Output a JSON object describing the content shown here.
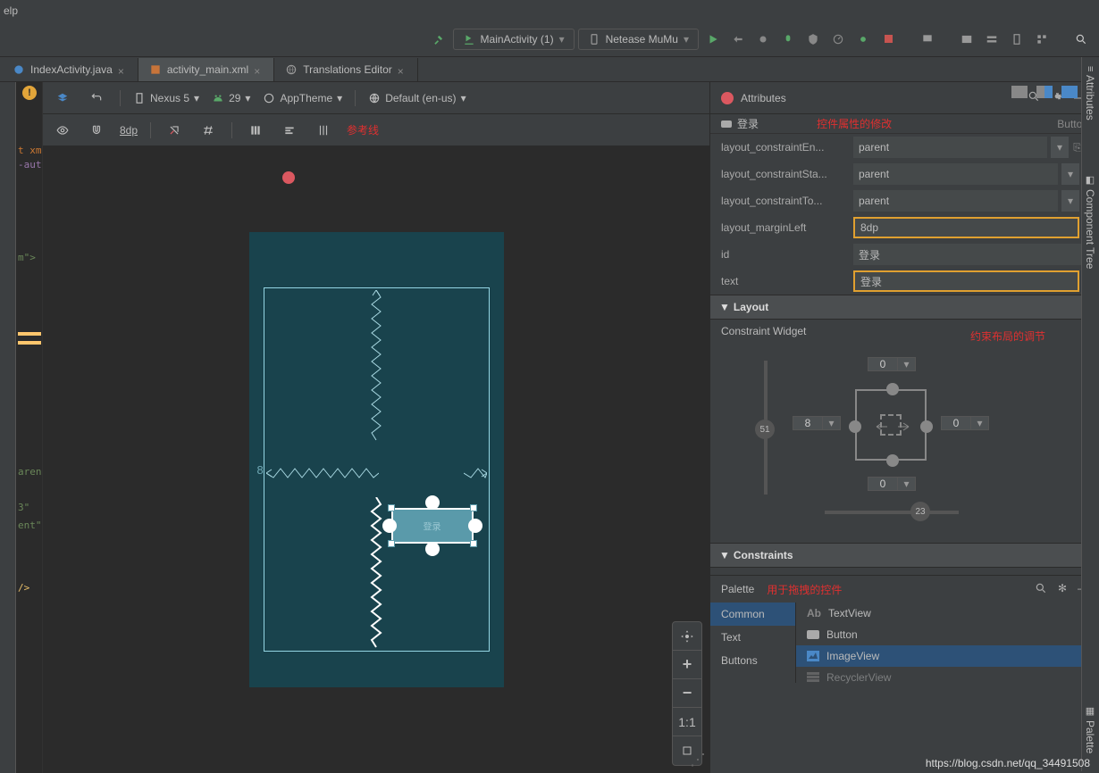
{
  "menu": {
    "help": "elp"
  },
  "toolbar": {
    "run_config": "MainActivity (1)",
    "device": "Netease MuMu"
  },
  "tabs": {
    "t1": "IndexActivity.java",
    "t2": "activity_main.xml",
    "t3": "Translations Editor"
  },
  "designer_bar": {
    "device": "Nexus 5",
    "api": "29",
    "theme": "AppTheme",
    "locale": "Default (en-us)"
  },
  "designer_bar2": {
    "margin": "8dp",
    "guide": "参考线"
  },
  "canvas": {
    "margin_left": "8",
    "button_text": "登录"
  },
  "zoom": {
    "oneone": "1:1"
  },
  "attributes": {
    "title": "Attributes",
    "component": "登录",
    "component_type": "Button",
    "annot_props": "控件属性的修改",
    "props": {
      "constraintEnd_label": "layout_constraintEn...",
      "constraintEnd_val": "parent",
      "constraintStart_label": "layout_constraintSta...",
      "constraintStart_val": "parent",
      "constraintTop_label": "layout_constraintTo...",
      "constraintTop_val": "parent",
      "marginLeft_label": "layout_marginLeft",
      "marginLeft_val": "8dp",
      "id_label": "id",
      "id_val": "登录",
      "text_label": "text",
      "text_val": "登录"
    },
    "layout_section": "Layout",
    "widget_label": "Constraint Widget",
    "annot_widget": "约束布局的调节",
    "margins": {
      "top": "0",
      "left": "8",
      "right": "0",
      "bottom": "0"
    },
    "bias": {
      "h": "51",
      "v": "23"
    },
    "endzero": "0",
    "constraints_section": "Constraints"
  },
  "palette": {
    "title": "Palette",
    "annot": "用于拖拽的控件",
    "cats": {
      "common": "Common",
      "text": "Text",
      "buttons": "Buttons"
    },
    "items": {
      "textview": "TextView",
      "textview_pre": "Ab",
      "button": "Button",
      "imageview": "ImageView",
      "recycler": "RecyclerView"
    }
  },
  "side_tabs": {
    "attributes": "Attributes",
    "component_tree": "Component Tree",
    "palette": "Palette"
  },
  "watermark": "https://blog.csdn.net/qq_34491508"
}
